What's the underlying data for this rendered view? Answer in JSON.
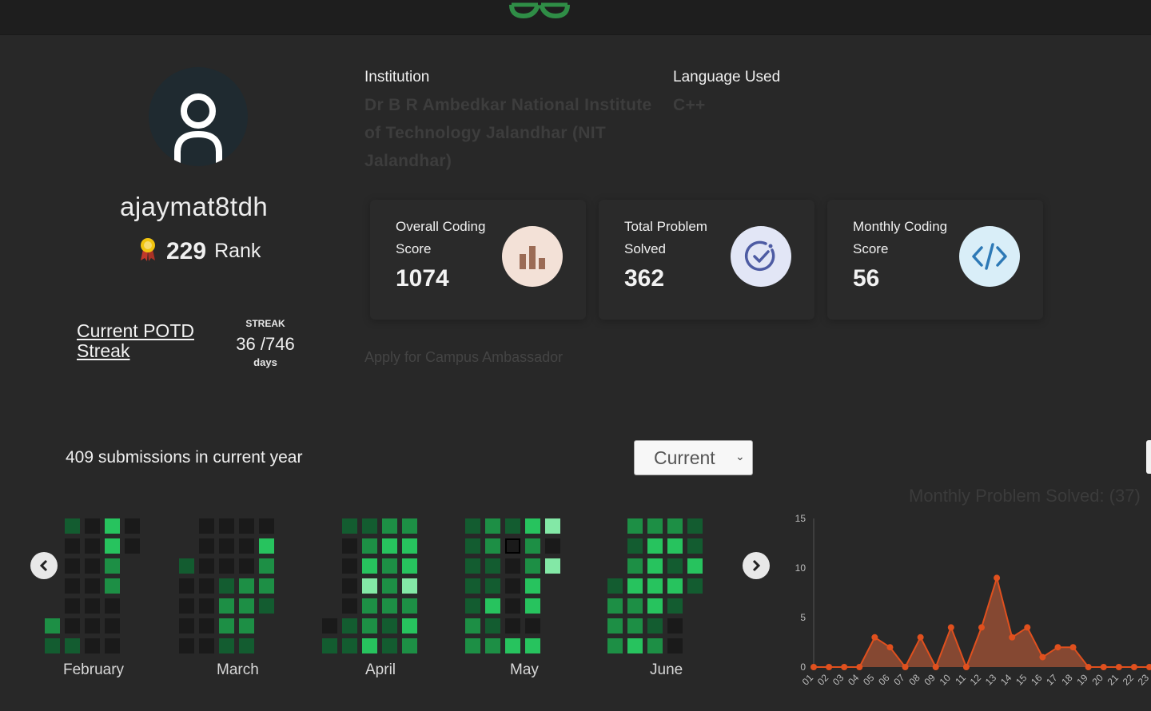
{
  "header": {
    "logo_icon": "gfg-logo-icon"
  },
  "profile": {
    "username": "ajaymat8tdh",
    "rank_value": "229",
    "rank_label": "Rank",
    "avatar_icon": "user-icon"
  },
  "potd": {
    "link_label": "Current POTD Streak",
    "streak_title": "STREAK",
    "streak_value": "36 /746",
    "streak_unit": "days"
  },
  "institution": {
    "label": "Institution",
    "value": "Dr B R Ambedkar National Institute of Technology Jalandhar (NIT Jalandhar)"
  },
  "language": {
    "label": "Language Used",
    "value": "C++"
  },
  "cards": [
    {
      "title": "Overall Coding Score",
      "value": "1074",
      "icon": "bar-chart-icon",
      "icon_bg": "#f3e1d7",
      "icon_color": "#9b6b55"
    },
    {
      "title": "Total Problem Solved",
      "value": "362",
      "icon": "check-circle-icon",
      "icon_bg": "#e2e6f6",
      "icon_color": "#4d5ba3"
    },
    {
      "title": "Monthly Coding Score",
      "value": "56",
      "icon": "code-icon",
      "icon_bg": "#d9eef8",
      "icon_color": "#2d79b6"
    }
  ],
  "ambassador_link": "Apply for Campus Ambassador",
  "submissions_text": "409 submissions in current year",
  "year_select": {
    "selected": "Current"
  },
  "heatmap": {
    "months": [
      "February",
      "March",
      "April",
      "May",
      "June"
    ],
    "colors": {
      "0": "#1a1a1a",
      "1": "#135c30",
      "2": "#1d8f45",
      "3": "#27c35e",
      "4": "#83e8a6"
    }
  },
  "chart_data": {
    "type": "line",
    "title": "Monthly Problem Solved: (37)",
    "x": [
      "01",
      "02",
      "03",
      "04",
      "05",
      "06",
      "07",
      "08",
      "09",
      "10",
      "11",
      "12",
      "13",
      "14",
      "15",
      "16",
      "17",
      "18",
      "19",
      "20",
      "21",
      "22",
      "23"
    ],
    "values": [
      0,
      0,
      0,
      0,
      3,
      2,
      0,
      3,
      0,
      4,
      0,
      4,
      9,
      3,
      4,
      1,
      2,
      2,
      0,
      0,
      0,
      0,
      0
    ],
    "ylim": [
      0,
      15
    ],
    "yticks": [
      0,
      5,
      10,
      15
    ],
    "color": "#e0501e",
    "fill": "#8a4a33"
  }
}
